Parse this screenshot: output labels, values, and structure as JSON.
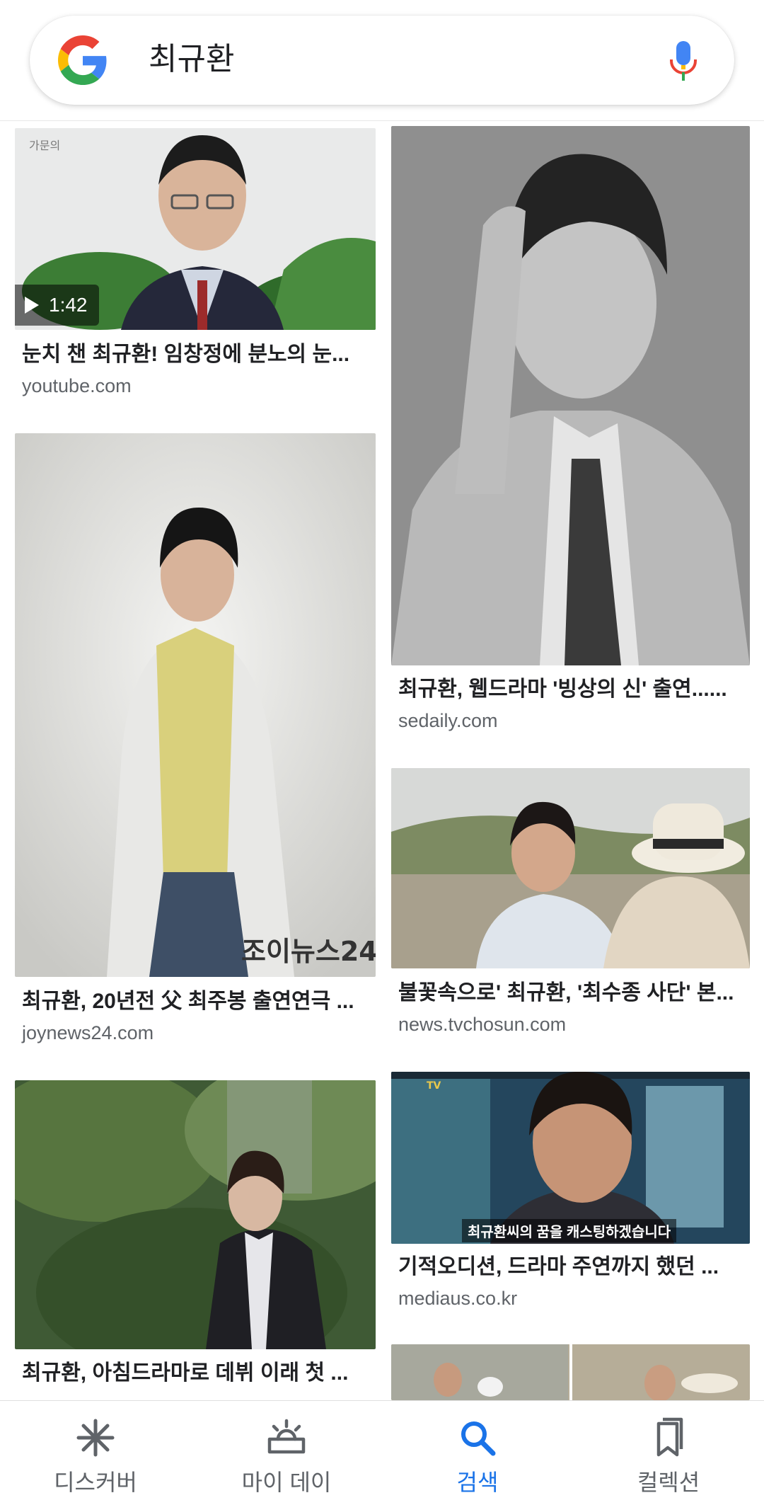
{
  "search": {
    "query": "최규환"
  },
  "results": [
    {
      "title": "눈치 챈 최규환! 임창정에 분노의 눈...",
      "source": "youtube.com",
      "duration": "1:42"
    },
    {
      "title": "최규환, 20년전 父 최주봉 출연연극 ...",
      "source": "joynews24.com",
      "watermark": "조이뉴스24"
    },
    {
      "title": "최규환, 아침드라마로 데뷔 이래 첫 ...",
      "source": ""
    },
    {
      "title": "최규환, 웹드라마 '빙상의 신' 출연......",
      "source": "sedaily.com"
    },
    {
      "title": "불꽃속으로' 최규환, '최수종 사단' 본...",
      "source": "news.tvchosun.com"
    },
    {
      "title": "기적오디션, 드라마 주연까지 했던 ...",
      "source": "mediaus.co.kr",
      "caption": "최규환씨의 꿈을 캐스팅하겠습니다"
    }
  ],
  "nav": {
    "items": [
      {
        "label": "디스커버",
        "icon": "asterisk-icon"
      },
      {
        "label": "마이 데이",
        "icon": "sunrise-icon"
      },
      {
        "label": "검색",
        "icon": "search-icon",
        "active": true
      },
      {
        "label": "컬렉션",
        "icon": "bookmarks-icon"
      }
    ]
  },
  "colors": {
    "accent": "#1a73e8",
    "text": "#202124",
    "secondary": "#5f6368"
  }
}
